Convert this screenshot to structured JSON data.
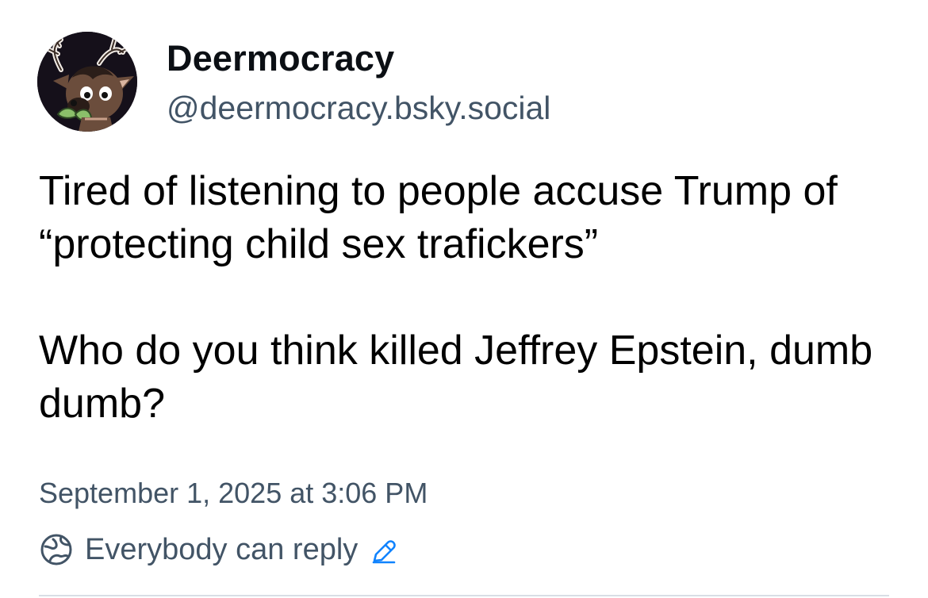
{
  "author": {
    "display_name": "Deermocracy",
    "handle": "@deermocracy.bsky.social",
    "avatar_icon": "deer-avatar"
  },
  "post": {
    "paragraphs": [
      "Tired of listening to people accuse Trump of “protecting child sex trafickers”",
      "Who do you think killed Jeffrey Epstein, dumb dumb?"
    ],
    "timestamp": "September 1, 2025 at 3:06 PM"
  },
  "reply_settings": {
    "label": "Everybody can reply",
    "icon": "globe-icon",
    "edit_icon": "pencil-icon"
  },
  "colors": {
    "text_primary": "#000000",
    "text_secondary": "#425466",
    "accent": "#1083fe",
    "divider": "#d8dee5"
  }
}
